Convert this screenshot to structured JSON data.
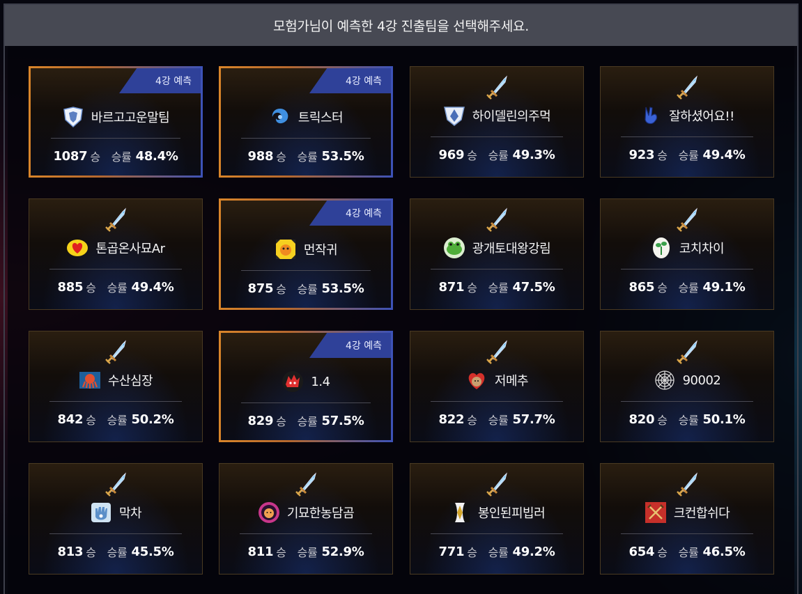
{
  "header": {
    "title": "모험가님이 예측한 4강 진출팀을 선택해주세요."
  },
  "labels": {
    "badge": "4강 예측",
    "wins_unit": "승",
    "rate_label": "승률"
  },
  "colors": {
    "header_bg": "#474953",
    "badge_bg": "#2f4199",
    "predicted_border_start": "#d9852a",
    "predicted_border_end": "#3c52b8"
  },
  "teams": [
    {
      "name": "바르고고운말팀",
      "wins": "1087",
      "rate": "48.4%",
      "predicted": true,
      "logo": "shield-emblem-icon"
    },
    {
      "name": "트릭스터",
      "wins": "988",
      "rate": "53.5%",
      "predicted": true,
      "logo": "swirl-emblem-icon"
    },
    {
      "name": "하이델린의주먹",
      "wins": "969",
      "rate": "49.3%",
      "predicted": false,
      "logo": "crest-emblem-icon"
    },
    {
      "name": "잘하셨어요!!",
      "wins": "923",
      "rate": "49.4%",
      "predicted": false,
      "logo": "victory-hand-icon"
    },
    {
      "name": "톤곱온사묘Ar",
      "wins": "885",
      "rate": "49.4%",
      "predicted": false,
      "logo": "heart-emblem-icon"
    },
    {
      "name": "먼작귀",
      "wins": "875",
      "rate": "53.5%",
      "predicted": true,
      "logo": "yellow-pattern-emblem-icon"
    },
    {
      "name": "광개토대왕강림",
      "wins": "871",
      "rate": "47.5%",
      "predicted": false,
      "logo": "frog-emblem-icon"
    },
    {
      "name": "코치차이",
      "wins": "865",
      "rate": "49.1%",
      "predicted": false,
      "logo": "sprout-emblem-icon"
    },
    {
      "name": "수산심장",
      "wins": "842",
      "rate": "50.2%",
      "predicted": false,
      "logo": "octopus-emblem-icon"
    },
    {
      "name": "1.4",
      "wins": "829",
      "rate": "57.5%",
      "predicted": true,
      "logo": "red-creature-emblem-icon"
    },
    {
      "name": "저메추",
      "wins": "822",
      "rate": "57.7%",
      "predicted": false,
      "logo": "heart-character-emblem-icon"
    },
    {
      "name": "90002",
      "wins": "820",
      "rate": "50.1%",
      "predicted": false,
      "logo": "web-emblem-icon"
    },
    {
      "name": "막차",
      "wins": "813",
      "rate": "45.5%",
      "predicted": false,
      "logo": "hamsa-emblem-icon"
    },
    {
      "name": "기묘한농담곰",
      "wins": "811",
      "rate": "52.9%",
      "predicted": false,
      "logo": "bear-ring-emblem-icon"
    },
    {
      "name": "봉인된피빕러",
      "wins": "771",
      "rate": "49.2%",
      "predicted": false,
      "logo": "sealed-diamond-emblem-icon"
    },
    {
      "name": "크컨합쉬다",
      "wins": "654",
      "rate": "46.5%",
      "predicted": false,
      "logo": "crossed-swords-emblem-icon"
    }
  ]
}
